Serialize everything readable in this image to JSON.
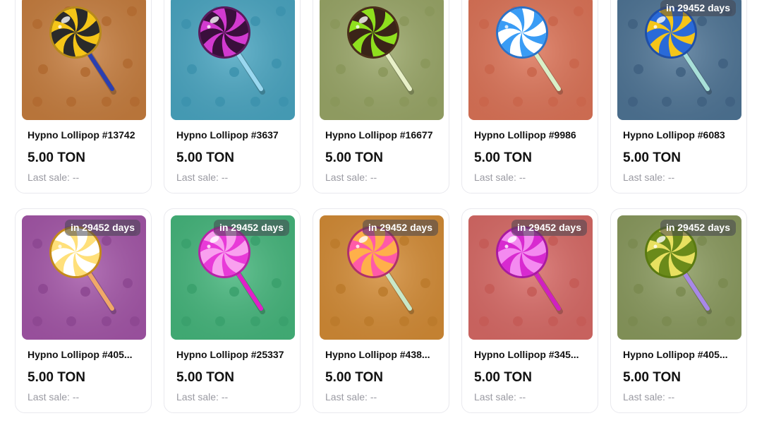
{
  "currency_price": "5.00 TON",
  "last_sale_label": "Last sale: --",
  "cards": [
    {
      "name": "Hypno Lollipop #13742",
      "price": "5.00 TON",
      "last_sale": "Last sale: --",
      "badge": "",
      "bg": "#c77e3f",
      "pattern": "#b06a30",
      "candy_a": "#f5c518",
      "candy_b": "#2a2a2a",
      "rim": "#b88a1a",
      "stick": "#2b3fb0"
    },
    {
      "name": "Hypno Lollipop #3637",
      "price": "5.00 TON",
      "last_sale": "Last sale: --",
      "badge": "",
      "bg": "#4aa6c2",
      "pattern": "#3c92ad",
      "candy_a": "#d23ad0",
      "candy_b": "#3a0f3c",
      "rim": "#5a1a5c",
      "stick": "#9ad8f0"
    },
    {
      "name": "Hypno Lollipop #16677",
      "price": "5.00 TON",
      "last_sale": "Last sale: --",
      "badge": "",
      "bg": "#9aa768",
      "pattern": "#8a975a",
      "candy_a": "#8fe01e",
      "candy_b": "#3a2418",
      "rim": "#4a2e1a",
      "stick": "#e8f0c8"
    },
    {
      "name": "Hypno Lollipop #9986",
      "price": "5.00 TON",
      "last_sale": "Last sale: --",
      "badge": "",
      "bg": "#dd7458",
      "pattern": "#c9654b",
      "candy_a": "#3a9cf5",
      "candy_b": "#ffffff",
      "rim": "#2a72c8",
      "stick": "#d8f0c8"
    },
    {
      "name": "Hypno Lollipop #6083",
      "price": "5.00 TON",
      "last_sale": "Last sale: --",
      "badge": "in 29452 days",
      "bg": "#4f7596",
      "pattern": "#3f6080",
      "candy_a": "#f5c518",
      "candy_b": "#2a6ad8",
      "rim": "#1f4fa8",
      "stick": "#a8e0d8"
    },
    {
      "name": "Hypno Lollipop #405...",
      "price": "5.00 TON",
      "last_sale": "Last sale: --",
      "badge": "in 29452 days",
      "bg": "#a456a8",
      "pattern": "#8c4690",
      "candy_a": "#ffe07a",
      "candy_b": "#ffffff",
      "rim": "#c48a1a",
      "stick": "#f0a868"
    },
    {
      "name": "Hypno Lollipop #25337",
      "price": "5.00 TON",
      "last_sale": "Last sale: --",
      "badge": "in 29452 days",
      "bg": "#45b67c",
      "pattern": "#3aa06c",
      "candy_a": "#e83ad8",
      "candy_b": "#f9a0ef",
      "rim": "#b822a8",
      "stick": "#e020c8"
    },
    {
      "name": "Hypno Lollipop #438...",
      "price": "5.00 TON",
      "last_sale": "Last sale: --",
      "badge": "in 29452 days",
      "bg": "#d48c36",
      "pattern": "#bb7a2c",
      "candy_a": "#ff5aa8",
      "candy_b": "#ffb04a",
      "rim": "#b0306c",
      "stick": "#c8e8c8"
    },
    {
      "name": "Hypno Lollipop #345...",
      "price": "5.00 TON",
      "last_sale": "Last sale: --",
      "badge": "in 29452 days",
      "bg": "#d86a66",
      "pattern": "#c45a56",
      "candy_a": "#d82ad0",
      "candy_b": "#f48af0",
      "rim": "#a81aa0",
      "stick": "#d020c0"
    },
    {
      "name": "Hypno Lollipop #405...",
      "price": "5.00 TON",
      "last_sale": "Last sale: --",
      "badge": "in 29452 days",
      "bg": "#8a9a5e",
      "pattern": "#7a8a50",
      "candy_a": "#e8e060",
      "candy_b": "#6a8a1a",
      "rim": "#5a7a10",
      "stick": "#a888e8"
    }
  ]
}
